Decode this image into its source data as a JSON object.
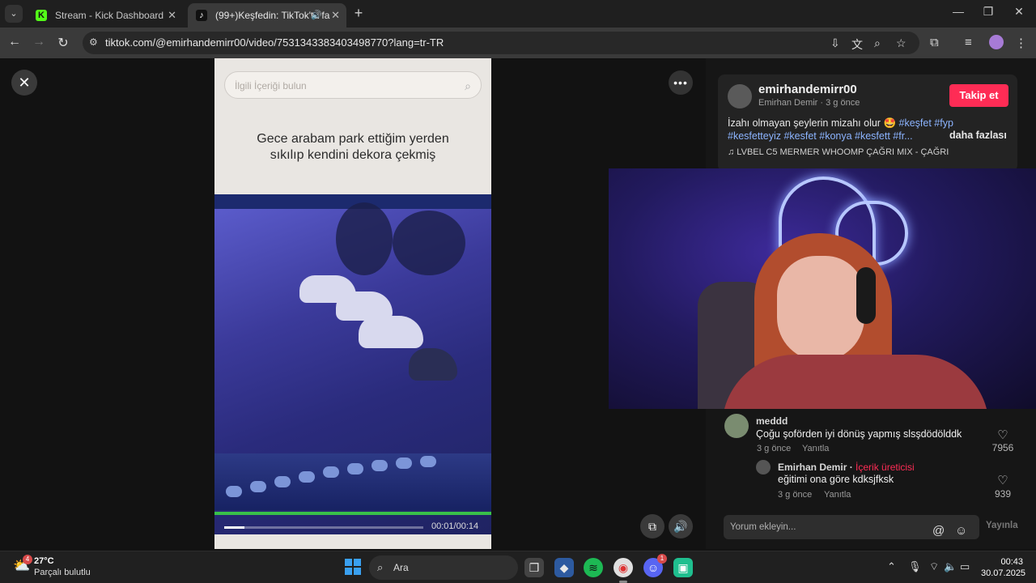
{
  "browser": {
    "tabs": [
      {
        "title": "Stream - Kick Dashboard",
        "icon": "kick-logo-icon"
      },
      {
        "title": "(99+)Keşfedin: TikTok'ta fa",
        "icon": "tiktok-logo-icon"
      }
    ],
    "url": "tiktok.com/@emirhandemirr00/video/7531343383403498770?lang=tr-TR"
  },
  "video": {
    "search_placeholder": "İlgili İçeriği bulun",
    "caption": "Gece arabam park ettiğim yerden sıkılıp kendini dekora çekmiş",
    "time": "00:01/00:14",
    "progress": 0.1
  },
  "post": {
    "username": "emirhandemirr00",
    "meta": "Emirhan Demir · 3 g önce",
    "follow_label": "Takip et",
    "description": "İzahı olmayan şeylerin mizahı olur 🤩",
    "tags": "#keşfet #fyp #kesfetteyiz #kesfet #konya #kesfett #fr...",
    "more_label": "daha fazlası",
    "music": "♫  LVBEL C5 MERMER WHOOMP ÇAĞRI MIX - ÇAĞRI"
  },
  "comments": [
    {
      "name": "meddd",
      "text": "Çoğu şoförden iyi dönüş yapmış slsşdödölddk",
      "time": "3 g önce",
      "reply": "Yanıtla",
      "likes": "7956"
    },
    {
      "name": "Emirhan Demir",
      "badge": "İçerik üreticisi",
      "text": "eğitimi ona göre kdksjfksk",
      "time": "3 g önce",
      "reply": "Yanıtla",
      "likes": "939"
    }
  ],
  "comment_input": {
    "placeholder": "Yorum ekleyin...",
    "post_label": "Yayınla"
  },
  "taskbar": {
    "weather_temp": "27°C",
    "weather_cond": "Parçalı bulutlu",
    "weather_badge": "4",
    "search_label": "Ara",
    "discord_badge": "1",
    "time": "00:43",
    "date": "30.07.2025"
  },
  "colors": {
    "accent": "#fe2c55",
    "tag": "#8cb4ff",
    "kick": "#53fc18"
  }
}
